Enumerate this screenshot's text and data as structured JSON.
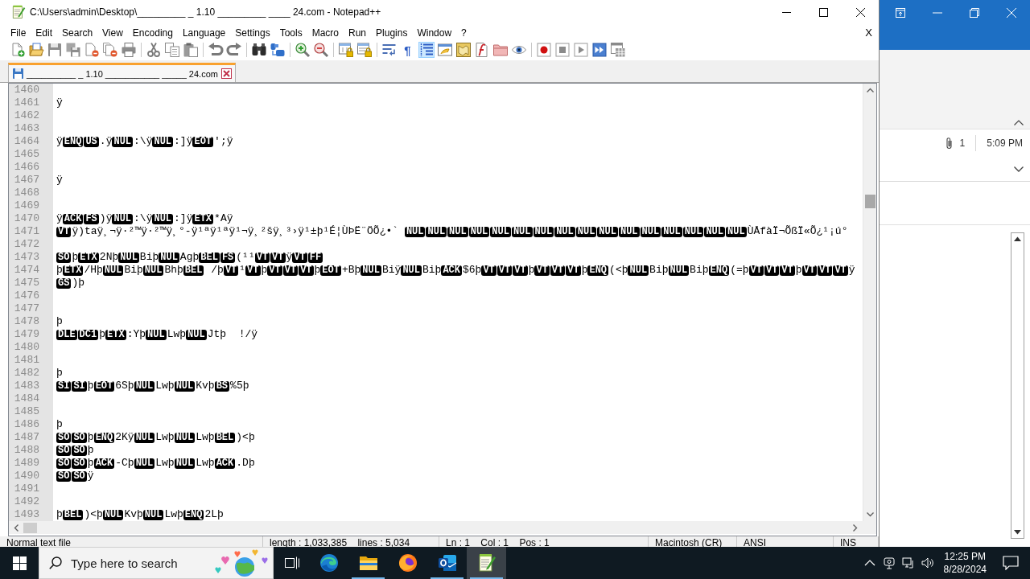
{
  "window": {
    "title": "C:\\Users\\admin\\Desktop\\_________ _ 1.10 _________ ____ 24.com - Notepad++"
  },
  "menu": [
    "File",
    "Edit",
    "Search",
    "View",
    "Encoding",
    "Language",
    "Settings",
    "Tools",
    "Macro",
    "Run",
    "Plugins",
    "Window",
    "?"
  ],
  "menu_close": "X",
  "toolbar": [
    [
      {
        "kind": "new",
        "on": false
      },
      {
        "kind": "open",
        "on": false
      },
      {
        "kind": "save",
        "on": false
      },
      {
        "kind": "saveall",
        "on": false
      },
      {
        "kind": "close",
        "on": false
      },
      {
        "kind": "closeall",
        "on": false
      },
      {
        "kind": "print",
        "on": false
      }
    ],
    [
      {
        "kind": "cut",
        "on": false
      },
      {
        "kind": "copy",
        "on": false
      },
      {
        "kind": "paste",
        "on": false
      }
    ],
    [
      {
        "kind": "undo",
        "on": false
      },
      {
        "kind": "redo",
        "on": false
      }
    ],
    [
      {
        "kind": "find",
        "on": false
      },
      {
        "kind": "replace",
        "on": false
      }
    ],
    [
      {
        "kind": "zoomin",
        "on": false
      },
      {
        "kind": "zoomout",
        "on": false
      }
    ],
    [
      {
        "kind": "syncv",
        "on": false
      },
      {
        "kind": "synch",
        "on": false
      }
    ],
    [
      {
        "kind": "wrap",
        "on": false
      },
      {
        "kind": "char",
        "text": "¶",
        "on": false
      },
      {
        "kind": "indent",
        "on": true
      },
      {
        "kind": "udl",
        "on": false
      },
      {
        "kind": "docmap",
        "on": false
      },
      {
        "kind": "funclist",
        "on": false
      },
      {
        "kind": "folder",
        "on": false
      },
      {
        "kind": "monitor",
        "on": false
      }
    ],
    [
      {
        "kind": "record",
        "on": false
      },
      {
        "kind": "stop",
        "on": false
      },
      {
        "kind": "play",
        "on": false
      },
      {
        "kind": "playmulti",
        "on": false
      },
      {
        "kind": "savemacro",
        "on": false
      }
    ]
  ],
  "tabs": [
    {
      "label": "__________ _ 1.10 ___________ _____ 24.com",
      "selected": true
    }
  ],
  "editor": {
    "lines": [
      {
        "number": "1460"
      },
      {
        "number": "1461",
        "segments": [
          {
            "kind": "text",
            "text": "ÿ"
          }
        ]
      },
      {
        "number": "1462"
      },
      {
        "number": "1463"
      },
      {
        "number": "1464",
        "segments": [
          {
            "kind": "text",
            "text": "ÿ"
          },
          {
            "kind": "ctrl",
            "text": "ENQ"
          },
          {
            "kind": "ctrl",
            "text": "US"
          },
          {
            "kind": "text",
            "text": ".ÿ"
          },
          {
            "kind": "ctrl",
            "text": "NUL"
          },
          {
            "kind": "text",
            "text": ":\\ÿ"
          },
          {
            "kind": "ctrl",
            "text": "NUL"
          },
          {
            "kind": "text",
            "text": ":]ÿ"
          },
          {
            "kind": "ctrl",
            "text": "EOT"
          },
          {
            "kind": "text",
            "text": "';ÿ"
          }
        ]
      },
      {
        "number": "1465"
      },
      {
        "number": "1466"
      },
      {
        "number": "1467",
        "segments": [
          {
            "kind": "text",
            "text": "ÿ"
          }
        ]
      },
      {
        "number": "1468"
      },
      {
        "number": "1469"
      },
      {
        "number": "1470",
        "segments": [
          {
            "kind": "text",
            "text": "ÿ"
          },
          {
            "kind": "ctrl",
            "text": "ACK"
          },
          {
            "kind": "ctrl",
            "text": "FS"
          },
          {
            "kind": "text",
            "text": ")ÿ"
          },
          {
            "kind": "ctrl",
            "text": "NUL"
          },
          {
            "kind": "text",
            "text": ":\\ÿ"
          },
          {
            "kind": "ctrl",
            "text": "NUL"
          },
          {
            "kind": "text",
            "text": ":]ÿ"
          },
          {
            "kind": "ctrl",
            "text": "ETX"
          },
          {
            "kind": "text",
            "text": "*Aÿ"
          }
        ]
      },
      {
        "number": "1471",
        "segments": [
          {
            "kind": "ctrl",
            "text": "VT"
          },
          {
            "kind": "text",
            "text": "ÿ)taÿ¸¬ÿ·²™ÿ·²™ÿ¸°-ÿ¹ªÿ¹ªÿ¹¬ÿ¸²šÿ¸³›ÿ¹±þ¹É¦ÙÞË¨ÖÕ¿•` "
          },
          {
            "kind": "ctrl",
            "text": "NUL"
          },
          {
            "kind": "ctrl",
            "text": "NUL"
          },
          {
            "kind": "ctrl",
            "text": "NUL"
          },
          {
            "kind": "ctrl",
            "text": "NUL"
          },
          {
            "kind": "ctrl",
            "text": "NUL"
          },
          {
            "kind": "ctrl",
            "text": "NUL"
          },
          {
            "kind": "ctrl",
            "text": "NUL"
          },
          {
            "kind": "ctrl",
            "text": "NUL"
          },
          {
            "kind": "ctrl",
            "text": "NUL"
          },
          {
            "kind": "ctrl",
            "text": "NUL"
          },
          {
            "kind": "ctrl",
            "text": "NUL"
          },
          {
            "kind": "ctrl",
            "text": "NUL"
          },
          {
            "kind": "ctrl",
            "text": "NUL"
          },
          {
            "kind": "ctrl",
            "text": "NUL"
          },
          {
            "kind": "ctrl",
            "text": "NUL"
          },
          {
            "kind": "ctrl",
            "text": "NUL"
          },
          {
            "kind": "text",
            "text": "ÙÅfàÏ¬ÕßÏ«Õ¿¹¡ú°"
          }
        ]
      },
      {
        "number": "1472"
      },
      {
        "number": "1473",
        "segments": [
          {
            "kind": "ctrl",
            "text": "SO"
          },
          {
            "kind": "text",
            "text": "þ"
          },
          {
            "kind": "ctrl",
            "text": "ETX"
          },
          {
            "kind": "text",
            "text": "2Nþ"
          },
          {
            "kind": "ctrl",
            "text": "NUL"
          },
          {
            "kind": "text",
            "text": "Biþ"
          },
          {
            "kind": "ctrl",
            "text": "NUL"
          },
          {
            "kind": "text",
            "text": "Agþ"
          },
          {
            "kind": "ctrl",
            "text": "BEL"
          },
          {
            "kind": "ctrl",
            "text": "FS"
          },
          {
            "kind": "text",
            "text": "(¹¹"
          },
          {
            "kind": "ctrl",
            "text": "VT"
          },
          {
            "kind": "ctrl",
            "text": "VT"
          },
          {
            "kind": "text",
            "text": "ÿ"
          },
          {
            "kind": "ctrl",
            "text": "VT"
          },
          {
            "kind": "ctrl",
            "text": "FF"
          }
        ]
      },
      {
        "number": "1474",
        "segments": [
          {
            "kind": "text",
            "text": "þ"
          },
          {
            "kind": "ctrl",
            "text": "ETX"
          },
          {
            "kind": "text",
            "text": "/Hþ"
          },
          {
            "kind": "ctrl",
            "text": "NUL"
          },
          {
            "kind": "text",
            "text": "Biþ"
          },
          {
            "kind": "ctrl",
            "text": "NUL"
          },
          {
            "kind": "text",
            "text": "Bhþ"
          },
          {
            "kind": "ctrl",
            "text": "BEL"
          },
          {
            "kind": "text",
            "text": " /þ"
          },
          {
            "kind": "ctrl",
            "text": "VT"
          },
          {
            "kind": "text",
            "text": "¹"
          },
          {
            "kind": "ctrl",
            "text": "VT"
          },
          {
            "kind": "text",
            "text": "þ"
          },
          {
            "kind": "ctrl",
            "text": "VT"
          },
          {
            "kind": "ctrl",
            "text": "VT"
          },
          {
            "kind": "ctrl",
            "text": "VT"
          },
          {
            "kind": "text",
            "text": "þ"
          },
          {
            "kind": "ctrl",
            "text": "EOT"
          },
          {
            "kind": "text",
            "text": "+Bþ"
          },
          {
            "kind": "ctrl",
            "text": "NUL"
          },
          {
            "kind": "text",
            "text": "Biÿ"
          },
          {
            "kind": "ctrl",
            "text": "NUL"
          },
          {
            "kind": "text",
            "text": "Biþ"
          },
          {
            "kind": "ctrl",
            "text": "ACK"
          },
          {
            "kind": "text",
            "text": "$6þ"
          },
          {
            "kind": "ctrl",
            "text": "VT"
          },
          {
            "kind": "ctrl",
            "text": "VT"
          },
          {
            "kind": "ctrl",
            "text": "VT"
          },
          {
            "kind": "text",
            "text": "þ"
          },
          {
            "kind": "ctrl",
            "text": "VT"
          },
          {
            "kind": "ctrl",
            "text": "VT"
          },
          {
            "kind": "ctrl",
            "text": "VT"
          },
          {
            "kind": "text",
            "text": "þ"
          },
          {
            "kind": "ctrl",
            "text": "ENQ"
          },
          {
            "kind": "text",
            "text": "(<þ"
          },
          {
            "kind": "ctrl",
            "text": "NUL"
          },
          {
            "kind": "text",
            "text": "Biþ"
          },
          {
            "kind": "ctrl",
            "text": "NUL"
          },
          {
            "kind": "text",
            "text": "Biþ"
          },
          {
            "kind": "ctrl",
            "text": "ENQ"
          },
          {
            "kind": "text",
            "text": "(=þ"
          },
          {
            "kind": "ctrl",
            "text": "VT"
          },
          {
            "kind": "ctrl",
            "text": "VT"
          },
          {
            "kind": "ctrl",
            "text": "VT"
          },
          {
            "kind": "text",
            "text": "þ"
          },
          {
            "kind": "ctrl",
            "text": "VT"
          },
          {
            "kind": "ctrl",
            "text": "VT"
          },
          {
            "kind": "ctrl",
            "text": "VT"
          },
          {
            "kind": "text",
            "text": "ÿ"
          }
        ]
      },
      {
        "number": "1475",
        "segments": [
          {
            "kind": "ctrl",
            "text": "GS"
          },
          {
            "kind": "text",
            "text": ")þ"
          }
        ]
      },
      {
        "number": "1476"
      },
      {
        "number": "1477"
      },
      {
        "number": "1478",
        "segments": [
          {
            "kind": "text",
            "text": "þ"
          }
        ]
      },
      {
        "number": "1479",
        "segments": [
          {
            "kind": "ctrl",
            "text": "DLE"
          },
          {
            "kind": "ctrl",
            "text": "DC1"
          },
          {
            "kind": "text",
            "text": "þ"
          },
          {
            "kind": "ctrl",
            "text": "ETX"
          },
          {
            "kind": "text",
            "text": ":Yþ"
          },
          {
            "kind": "ctrl",
            "text": "NUL"
          },
          {
            "kind": "text",
            "text": "Lwþ"
          },
          {
            "kind": "ctrl",
            "text": "NUL"
          },
          {
            "kind": "text",
            "text": "Jtþ  !/ÿ"
          }
        ]
      },
      {
        "number": "1480"
      },
      {
        "number": "1481"
      },
      {
        "number": "1482",
        "segments": [
          {
            "kind": "text",
            "text": "þ"
          }
        ]
      },
      {
        "number": "1483",
        "segments": [
          {
            "kind": "ctrl",
            "text": "SI"
          },
          {
            "kind": "ctrl",
            "text": "SI"
          },
          {
            "kind": "text",
            "text": "þ"
          },
          {
            "kind": "ctrl",
            "text": "EOT"
          },
          {
            "kind": "text",
            "text": "6Sþ"
          },
          {
            "kind": "ctrl",
            "text": "NUL"
          },
          {
            "kind": "text",
            "text": "Lwþ"
          },
          {
            "kind": "ctrl",
            "text": "NUL"
          },
          {
            "kind": "text",
            "text": "Kvþ"
          },
          {
            "kind": "ctrl",
            "text": "BS"
          },
          {
            "kind": "text",
            "text": "%5þ"
          }
        ]
      },
      {
        "number": "1484"
      },
      {
        "number": "1485"
      },
      {
        "number": "1486",
        "segments": [
          {
            "kind": "text",
            "text": "þ"
          }
        ]
      },
      {
        "number": "1487",
        "segments": [
          {
            "kind": "ctrl",
            "text": "SO"
          },
          {
            "kind": "ctrl",
            "text": "SO"
          },
          {
            "kind": "text",
            "text": "þ"
          },
          {
            "kind": "ctrl",
            "text": "ENQ"
          },
          {
            "kind": "text",
            "text": "2Kÿ"
          },
          {
            "kind": "ctrl",
            "text": "NUL"
          },
          {
            "kind": "text",
            "text": "Lwþ"
          },
          {
            "kind": "ctrl",
            "text": "NUL"
          },
          {
            "kind": "text",
            "text": "Lwþ"
          },
          {
            "kind": "ctrl",
            "text": "BEL"
          },
          {
            "kind": "text",
            "text": ")<þ"
          }
        ]
      },
      {
        "number": "1488",
        "segments": [
          {
            "kind": "ctrl",
            "text": "SO"
          },
          {
            "kind": "ctrl",
            "text": "SO"
          },
          {
            "kind": "text",
            "text": "þ"
          }
        ]
      },
      {
        "number": "1489",
        "segments": [
          {
            "kind": "ctrl",
            "text": "SO"
          },
          {
            "kind": "ctrl",
            "text": "SO"
          },
          {
            "kind": "text",
            "text": "þ"
          },
          {
            "kind": "ctrl",
            "text": "ACK"
          },
          {
            "kind": "text",
            "text": "-Cþ"
          },
          {
            "kind": "ctrl",
            "text": "NUL"
          },
          {
            "kind": "text",
            "text": "Lwþ"
          },
          {
            "kind": "ctrl",
            "text": "NUL"
          },
          {
            "kind": "text",
            "text": "Lwþ"
          },
          {
            "kind": "ctrl",
            "text": "ACK"
          },
          {
            "kind": "text",
            "text": ".Dþ"
          }
        ]
      },
      {
        "number": "1490",
        "segments": [
          {
            "kind": "ctrl",
            "text": "SO"
          },
          {
            "kind": "ctrl",
            "text": "SO"
          },
          {
            "kind": "text",
            "text": "ÿ"
          }
        ]
      },
      {
        "number": "1491"
      },
      {
        "number": "1492"
      },
      {
        "number": "1493",
        "segments": [
          {
            "kind": "text",
            "text": "þ"
          },
          {
            "kind": "ctrl",
            "text": "BEL"
          },
          {
            "kind": "text",
            "text": ")<þ"
          },
          {
            "kind": "ctrl",
            "text": "NUL"
          },
          {
            "kind": "text",
            "text": "Kvþ"
          },
          {
            "kind": "ctrl",
            "text": "NUL"
          },
          {
            "kind": "text",
            "text": "Lwþ"
          },
          {
            "kind": "ctrl",
            "text": "ENQ"
          },
          {
            "kind": "text",
            "text": "2Lþ"
          }
        ]
      }
    ]
  },
  "status_bar": [
    "Normal text file",
    "length : 1,033,385    lines : 5,034",
    "Ln : 1    Col : 1    Pos : 1",
    "Macintosh (CR)",
    "ANSI",
    "INS"
  ],
  "background_window": {
    "attachments": "1",
    "time": "5:09 PM"
  },
  "taskbar": {
    "search": {
      "placeholder": "Type here to search"
    },
    "apps": [
      {
        "kind": "edge",
        "running": false,
        "active": false
      },
      {
        "kind": "explorer",
        "running": true,
        "active": false
      },
      {
        "kind": "firefox",
        "running": false,
        "active": false
      },
      {
        "kind": "outlook",
        "running": true,
        "active": false
      },
      {
        "kind": "notepad",
        "running": true,
        "active": true
      }
    ],
    "time": "12:25 PM",
    "date": "8/28/2024"
  }
}
